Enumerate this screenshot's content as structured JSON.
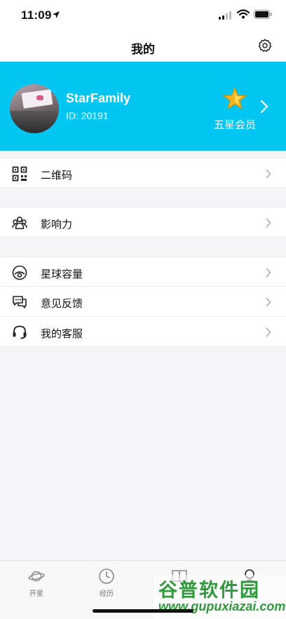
{
  "status_bar": {
    "time": "11:09"
  },
  "nav": {
    "title": "我的"
  },
  "profile": {
    "username": "StarFamily",
    "id_text": "ID: 20191",
    "member_level": "五星会员"
  },
  "menu_groups": [
    {
      "items": [
        {
          "label": "二维码",
          "icon": "qr-code-icon"
        }
      ]
    },
    {
      "items": [
        {
          "label": "影响力",
          "icon": "people-icon"
        }
      ]
    },
    {
      "items": [
        {
          "label": "星球容量",
          "icon": "storage-icon"
        },
        {
          "label": "意见反馈",
          "icon": "chat-bubbles-icon"
        },
        {
          "label": "我的客服",
          "icon": "headset-icon"
        }
      ]
    }
  ],
  "tabs": [
    {
      "label": "开星",
      "icon": "planet-icon"
    },
    {
      "label": "经历",
      "icon": "clock-icon"
    },
    {
      "label": "",
      "icon": "book-icon"
    },
    {
      "label": "",
      "icon": "user-icon"
    }
  ],
  "watermark": {
    "title": "谷普软件园",
    "url": "www.gupuxiazai.com"
  },
  "colors": {
    "accent": "#04c6f2",
    "star": "#f2b51d",
    "watermark": "#2f9a3c"
  }
}
